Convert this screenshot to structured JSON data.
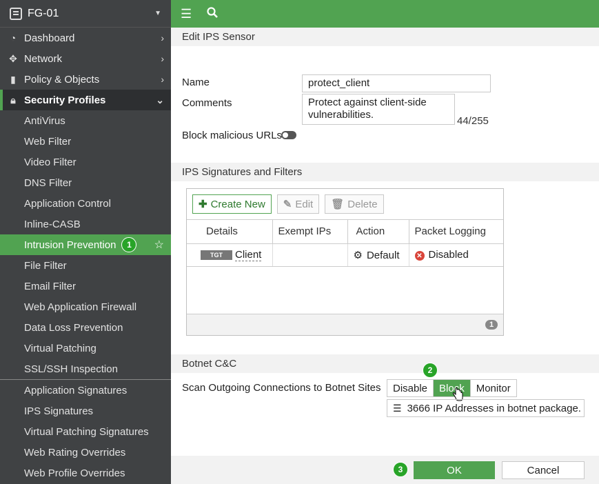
{
  "sidebar": {
    "device": "FG-01",
    "top_items": [
      {
        "label": "Dashboard",
        "icon": "dashboard-icon"
      },
      {
        "label": "Network",
        "icon": "network-icon"
      },
      {
        "label": "Policy & Objects",
        "icon": "policy-icon"
      }
    ],
    "section": {
      "label": "Security Profiles",
      "icon": "lock-icon"
    },
    "sub_items": [
      "AntiVirus",
      "Web Filter",
      "Video Filter",
      "DNS Filter",
      "Application Control",
      "Inline-CASB",
      "Intrusion Prevention",
      "File Filter",
      "Email Filter",
      "Web Application Firewall",
      "Data Loss Prevention",
      "Virtual Patching",
      "SSL/SSH Inspection"
    ],
    "sub_items_2": [
      "Application Signatures",
      "IPS Signatures",
      "Virtual Patching Signatures",
      "Web Rating Overrides",
      "Web Profile Overrides"
    ],
    "selected_index": 6,
    "step1": "1"
  },
  "topbar": {
    "menu_icon": "hamburger-icon",
    "search_icon": "search-icon"
  },
  "form": {
    "title": "Edit IPS Sensor",
    "name_label": "Name",
    "name_value": "protect_client",
    "comments_label": "Comments",
    "comments_value": "Protect against client-side vulnerabilities.",
    "comments_count": "44/255",
    "block_urls_label": "Block malicious URLs"
  },
  "signatures": {
    "title": "IPS Signatures and Filters",
    "create_new": "Create New",
    "edit": "Edit",
    "delete": "Delete",
    "columns": [
      "Details",
      "Exempt IPs",
      "Action",
      "Packet Logging"
    ],
    "row": {
      "tag": "TGT",
      "details": "Client",
      "exempt": "",
      "action": "Default",
      "logging": "Disabled"
    },
    "count": "1"
  },
  "botnet": {
    "title": "Botnet C&C",
    "scan_label": "Scan Outgoing Connections to Botnet Sites",
    "options": [
      "Disable",
      "Block",
      "Monitor"
    ],
    "selected": "Block",
    "info": "3666 IP Addresses in botnet package.",
    "step2": "2"
  },
  "footer": {
    "ok": "OK",
    "cancel": "Cancel",
    "step3": "3"
  },
  "colors": {
    "accent": "#51a351",
    "sidebar": "#404244"
  }
}
